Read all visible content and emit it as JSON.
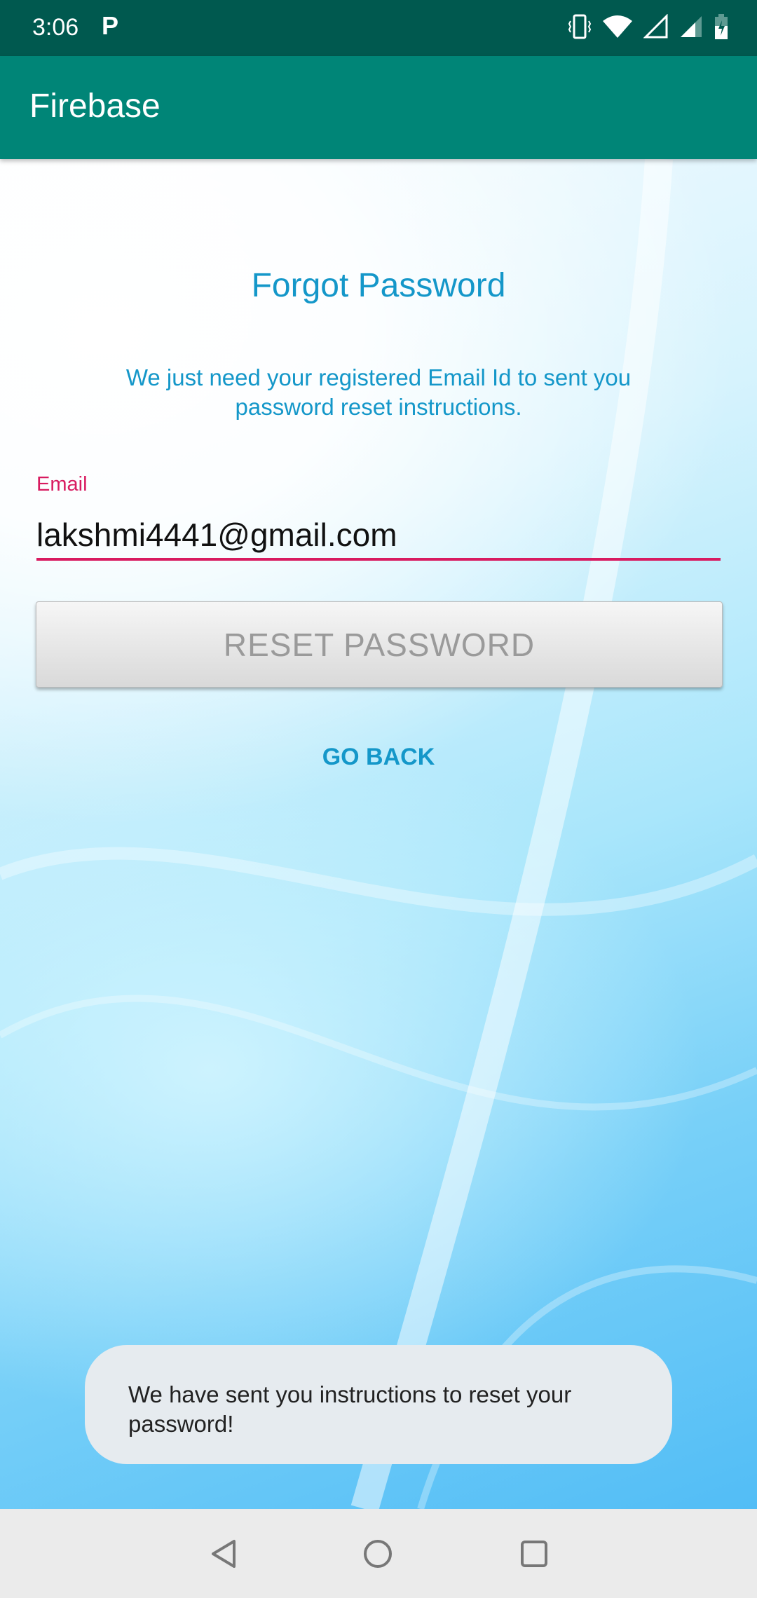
{
  "status_bar": {
    "time": "3:06",
    "notification_icon": "parking-icon",
    "icons": [
      "vibrate-icon",
      "wifi-icon",
      "signal-empty-icon",
      "signal-icon",
      "battery-charging-icon"
    ]
  },
  "app_bar": {
    "title": "Firebase"
  },
  "form": {
    "title": "Forgot Password",
    "subtitle_line1": "We just need your registered Email Id to sent you",
    "subtitle_line2": "password reset instructions.",
    "email_label": "Email",
    "email_value": "lakshmi4441@gmail.com",
    "reset_button": "RESET PASSWORD",
    "go_back": "GO BACK"
  },
  "toast": {
    "line1": "We have sent you instructions to reset your",
    "line2": "password!"
  },
  "colors": {
    "status_bar": "#00594f",
    "app_bar": "#008577",
    "accent": "#d81b60",
    "text_blue": "#1497c9"
  },
  "nav_bar": {
    "icons": [
      "back-icon",
      "home-icon",
      "recents-icon"
    ]
  }
}
